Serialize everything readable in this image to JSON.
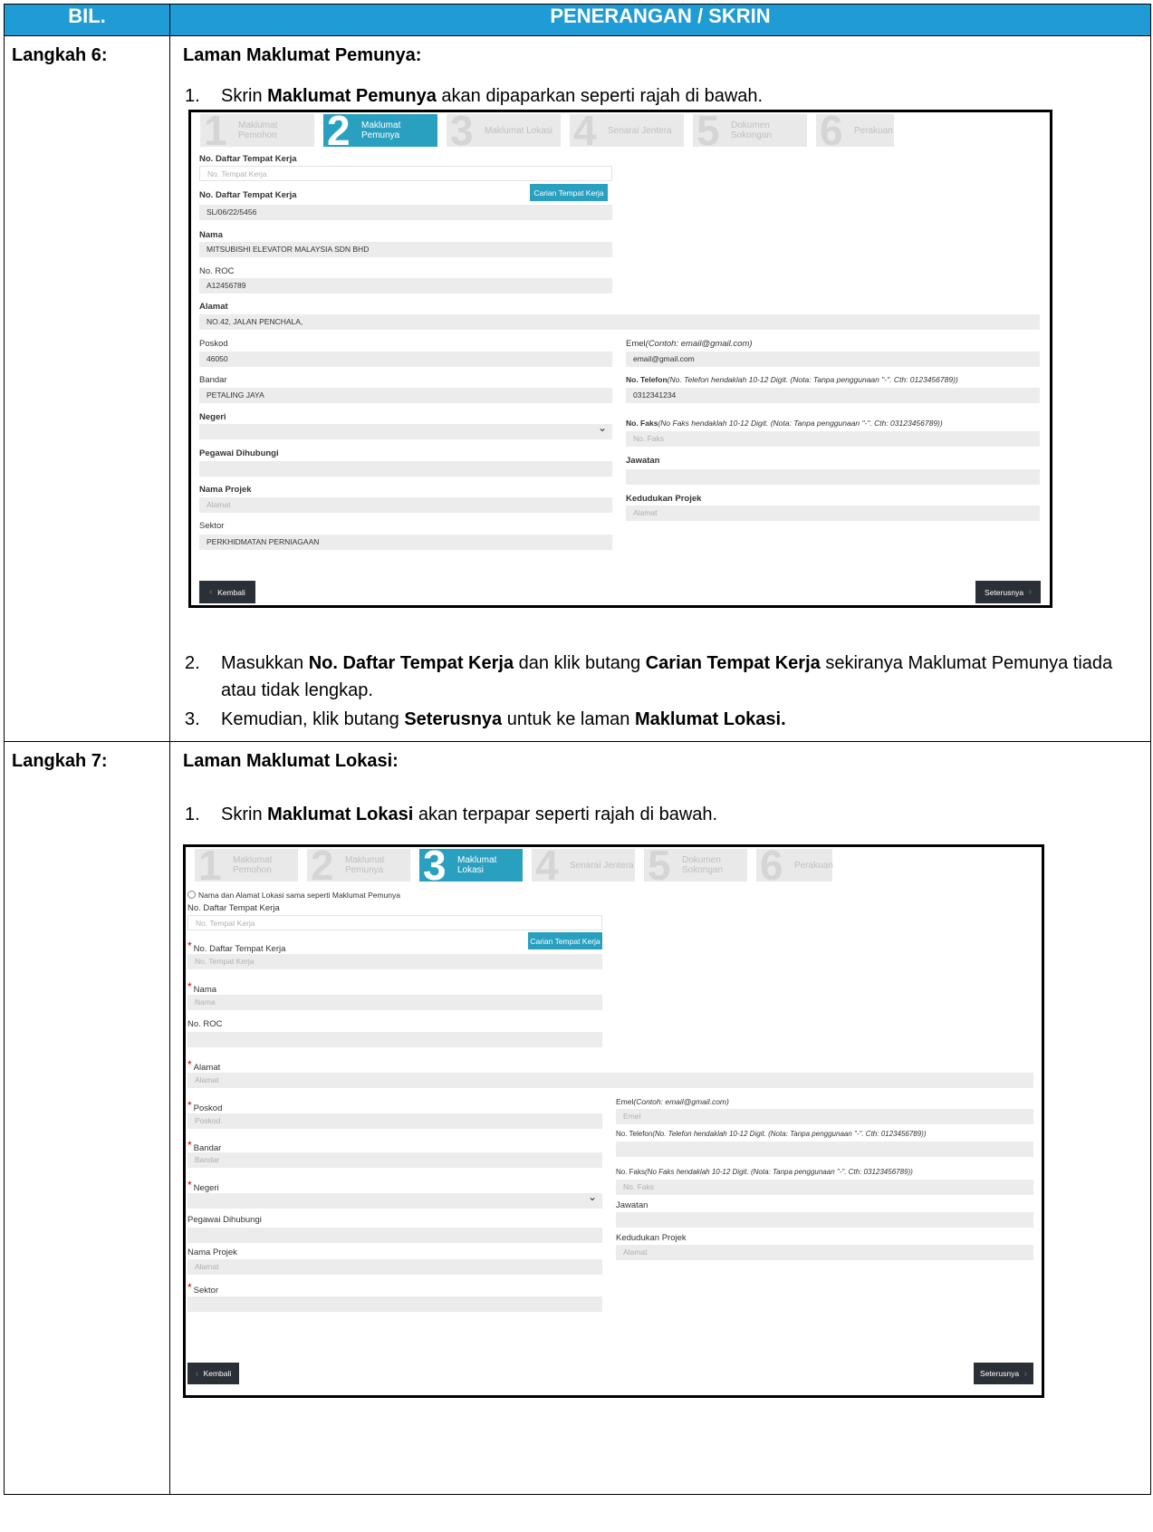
{
  "header": {
    "col1": "BIL.",
    "col2": "PENERANGAN / SKRIN"
  },
  "step6": {
    "label": "Langkah 6:",
    "title": "Laman Maklumat Pemunya:",
    "item1": {
      "num": "1.",
      "pre": "Skrin ",
      "bold": "Maklumat Pemunya",
      "post": " akan dipaparkan seperti rajah di bawah."
    },
    "item2": {
      "num": "2.",
      "pre": "Masukkan ",
      "bold1": "No. Daftar Tempat Kerja",
      "mid": " dan klik butang ",
      "bold2": "Carian Tempat Kerja",
      "post": " sekiranya Maklumat Pemunya tiada atau tidak lengkap."
    },
    "item3": {
      "num": "3.",
      "pre": "Kemudian, klik butang ",
      "bold1": "Seterusnya",
      "mid": " untuk ke laman ",
      "bold2": "Maklumat Lokasi."
    }
  },
  "step7": {
    "label": "Langkah 7:",
    "title": "Laman Maklumat Lokasi:",
    "item1": {
      "num": "1.",
      "pre": "Skrin ",
      "bold": "Maklumat Lokasi",
      "post": " akan terpapar seperti rajah di bawah."
    }
  },
  "tabs": [
    {
      "n": "1",
      "label": "Maklumat Pemohon"
    },
    {
      "n": "2",
      "label": "Maklumat Pemunya"
    },
    {
      "n": "3",
      "label": "Maklumat Lokasi"
    },
    {
      "n": "4",
      "label": "Senarai Jentera"
    },
    {
      "n": "5",
      "label": "Dokumen Sokongan"
    },
    {
      "n": "6",
      "label": "Perakuan"
    }
  ],
  "form1": {
    "search_label": "No. Daftar Tempat Kerja",
    "search_placeholder": "No. Tempat Kerja",
    "search_button": "Carian Tempat Kerja",
    "reg_label": "No. Daftar Tempat Kerja",
    "reg_value": "SL/06/22/5456",
    "nama_label": "Nama",
    "nama_value": "MITSUBISHI ELEVATOR MALAYSIA SDN BHD",
    "roc_label": "No. ROC",
    "roc_value": "A12456789",
    "alamat_label": "Alamat",
    "alamat_value": "NO.42, JALAN PENCHALA,",
    "poskod_label": "Poskod",
    "poskod_value": "46050",
    "bandar_label": "Bandar",
    "bandar_value": "PETALING JAYA",
    "negeri_label": "Negeri",
    "pegawai_label": "Pegawai Dihubungi",
    "projek_label": "Nama Projek",
    "projek_placeholder": "Alamat",
    "sektor_label": "Sektor",
    "sektor_value": "PERKHIDMATAN PERNIAGAAN",
    "emel_label": "Emel",
    "emel_hint": "(Contoh: email@gmail.com)",
    "emel_value": "email@gmail.com",
    "tel_label": "No. Telefon",
    "tel_hint": "(No. Telefon hendaklah 10-12 Digit. (Nota: Tanpa penggunaan \"-\". Cth: 0123456789))",
    "tel_value": "0312341234",
    "faks_label": "No. Faks",
    "faks_hint": "(No Faks hendaklah 10-12 Digit. (Nota: Tanpa penggunaan \"-\". Cth: 03123456789))",
    "faks_placeholder": "No. Faks",
    "jawatan_label": "Jawatan",
    "kedudukan_label": "Kedudukan Projek",
    "kedudukan_placeholder": "Alamat",
    "back_button": "Kembali",
    "next_button": "Seterusnya"
  },
  "form2": {
    "radio_label": "Nama dan Alamat Lokasi sama seperti Maklumat Pemunya",
    "search_label": "No. Daftar Tempat Kerja",
    "search_placeholder": "No. Tempat Kerja",
    "search_button": "Carian Tempat Kerja",
    "reg_label": "No. Daftar Tempat Kerja",
    "reg_placeholder": "No. Tempat Kerja",
    "nama_label": "Nama",
    "nama_placeholder": "Nama",
    "roc_label": "No. ROC",
    "alamat_label": "Alamat",
    "alamat_placeholder": "Alamat",
    "poskod_label": "Poskod",
    "poskod_placeholder": "Poskod",
    "bandar_label": "Bandar",
    "bandar_placeholder": "Bandar",
    "negeri_label": "Negeri",
    "pegawai_label": "Pegawai Dihubungi",
    "projek_label": "Nama Projek",
    "projek_placeholder": "Alamat",
    "sektor_label": "Sektor",
    "emel_label": "Emel",
    "emel_hint": "(Contoh: email@gmail.com)",
    "emel_placeholder": "Emel",
    "tel_label": "No. Telefon",
    "tel_hint": "(No. Telefon hendaklah 10-12 Digit. (Nota: Tanpa penggunaan \"-\". Cth: 0123456789))",
    "faks_label": "No. Faks",
    "faks_hint": "(No Faks hendaklah 10-12 Digit. (Nota: Tanpa penggunaan \"-\". Cth: 03123456789))",
    "faks_placeholder": "No. Faks",
    "jawatan_label": "Jawatan",
    "kedudukan_label": "Kedudukan Projek",
    "kedudukan_placeholder": "Alamat",
    "back_button": "Kembali",
    "next_button": "Seterusnya",
    "required_mark": "*"
  }
}
